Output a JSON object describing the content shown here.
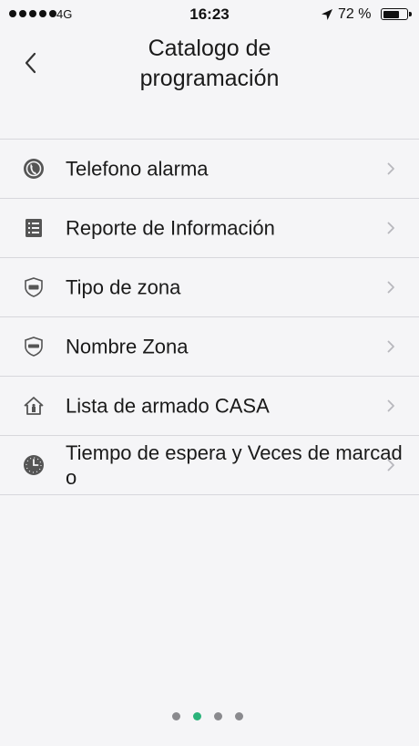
{
  "status_bar": {
    "carrier": "4G",
    "time": "16:23",
    "battery_percent": "72 %",
    "battery_level": 0.72
  },
  "header": {
    "back_icon": "chevron-left-icon",
    "title": "Catalogo de\nprogramación"
  },
  "menu": {
    "items": [
      {
        "label": "Telefono alarma",
        "icon": "phone-circle-icon"
      },
      {
        "label": "Reporte de Información",
        "icon": "report-list-icon"
      },
      {
        "label": "Tipo de zona",
        "icon": "zone-type-shield-icon"
      },
      {
        "label": "Nombre Zona",
        "icon": "zone-name-shield-icon"
      },
      {
        "label": "Lista de armado CASA",
        "icon": "home-arm-icon"
      },
      {
        "label": "Tiempo de espera y Veces de marcado",
        "icon": "clock-icon"
      }
    ]
  },
  "pager": {
    "count": 4,
    "active_index": 1,
    "active_color": "#2bb37a",
    "inactive_color": "#8a8a8e"
  }
}
